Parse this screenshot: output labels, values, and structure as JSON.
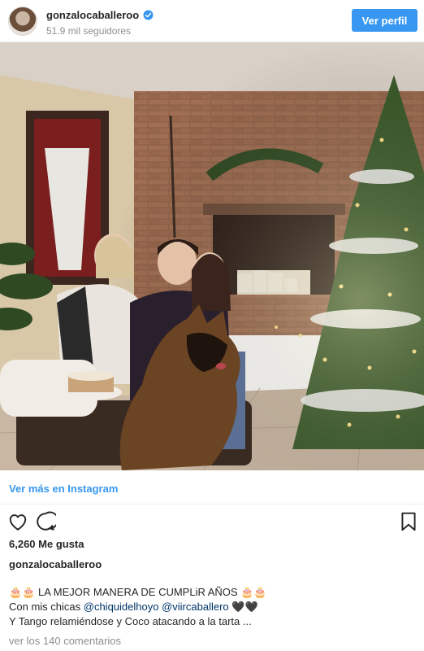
{
  "post": {
    "username": "gonzalocaballeroo",
    "followers": "51.9 mil seguidores",
    "view_profile_label": "Ver perfil",
    "view_more_label": "Ver más en Instagram",
    "likes": "6,260 Me gusta",
    "caption_username": "gonzalocaballeroo",
    "caption_line1": "🎂🎂 LA MEJOR MANERA DE CUMPLiR AÑOS 🎂🎂",
    "caption_line2_prefix": "Con mis chicas ",
    "mention1": "@chiquidelhoyo",
    "mention2": "@viircaballero",
    "caption_line2_suffix": " 🖤🖤",
    "caption_line3": "Y Tango relamiéndose y Coco atacando a la tarta ...",
    "comments_link": "ver los 140 comentarios"
  },
  "colors": {
    "accent": "#3897f0",
    "muted": "#8e8e8e",
    "text": "#262626"
  },
  "icons": [
    "verified-icon",
    "heart-icon",
    "comment-icon",
    "bookmark-icon"
  ]
}
